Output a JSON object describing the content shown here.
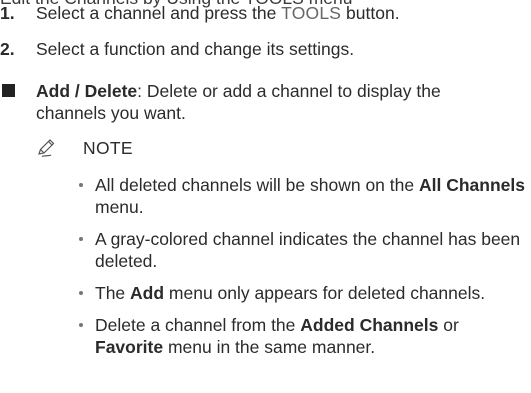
{
  "top_cut_line": "Edit the Channels by Using the TOOLS menu",
  "steps": [
    {
      "number": "1.",
      "before": "Select a channel and press the ",
      "highlight": "TOOLS",
      "after": " button."
    },
    {
      "number": "2.",
      "text": "Select a function and change its settings."
    }
  ],
  "bullet": {
    "term": "Add / Delete",
    "description": ": Delete or add a channel to display the channels you want."
  },
  "note": {
    "icon": "note-pencil-icon",
    "label": "NOTE",
    "items": [
      {
        "before": "All deleted channels will be shown on the ",
        "bold": "All Channels",
        "after": " menu."
      },
      {
        "text": "A gray-colored channel indicates the channel has been deleted."
      },
      {
        "before": "The ",
        "bold": "Add",
        "after": " menu only appears for deleted channels."
      },
      {
        "before": "Delete a channel from the ",
        "bold": "Added Channels",
        "middle": " or ",
        "bold2": "Favorite",
        "after": " menu in the same manner."
      }
    ]
  }
}
